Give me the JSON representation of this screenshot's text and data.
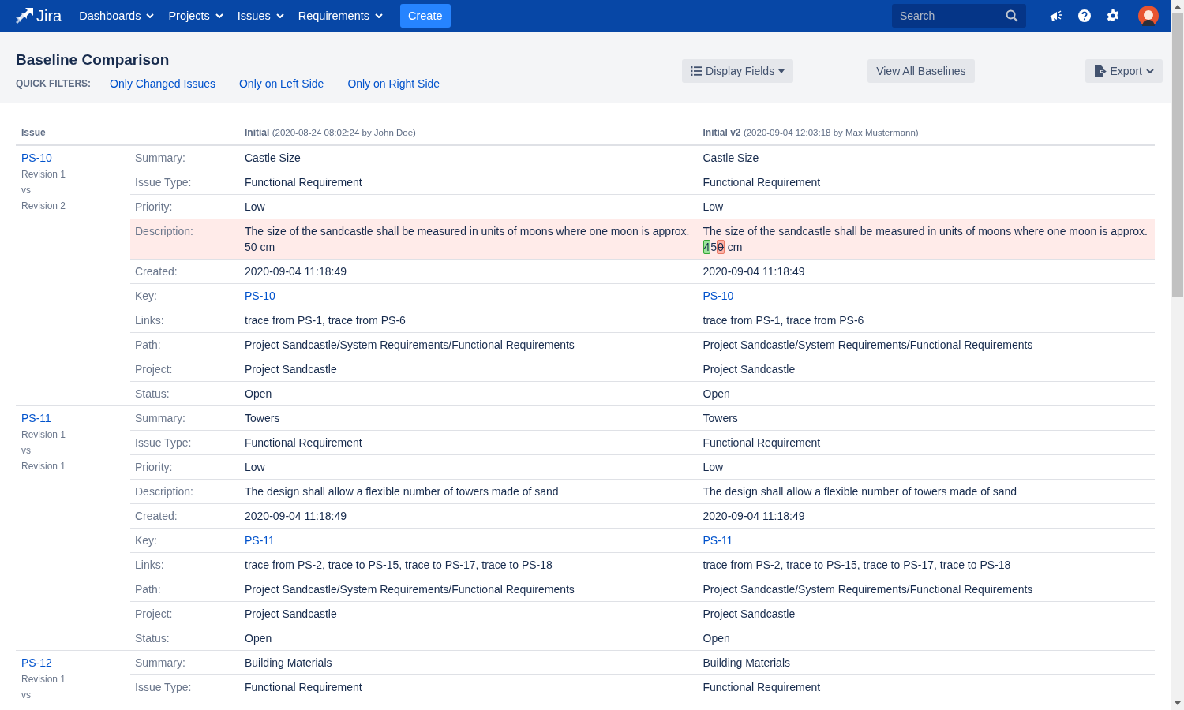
{
  "nav": {
    "logo": "Jira",
    "menus": [
      {
        "label": "Dashboards"
      },
      {
        "label": "Projects"
      },
      {
        "label": "Issues"
      },
      {
        "label": "Requirements"
      }
    ],
    "create": "Create",
    "search": {
      "placeholder": "Search"
    }
  },
  "page": {
    "title": "Baseline Comparison",
    "quick_filters_label": "QUICK FILTERS:",
    "quick_filters": [
      "Only Changed Issues",
      "Only on Left Side",
      "Only on Right Side"
    ],
    "buttons": {
      "display_fields": "Display Fields",
      "view_all": "View All Baselines",
      "export": "Export"
    }
  },
  "table": {
    "columns": {
      "issue": "Issue",
      "left_name": "Initial",
      "left_meta": "(2020-08-24 08:02:24 by John Doe)",
      "right_name": "Initial v2",
      "right_meta": "(2020-09-04 12:03:18 by Max Mustermann)"
    },
    "issues": [
      {
        "key": "PS-10",
        "revisions": [
          "Revision 1",
          "vs",
          "Revision 2"
        ],
        "rows": [
          {
            "label": "Summary:",
            "kind": "text",
            "changed": false,
            "left": "Castle Size",
            "right": "Castle Size"
          },
          {
            "label": "Issue Type:",
            "kind": "text",
            "changed": false,
            "left": "Functional Requirement",
            "right": "Functional Requirement"
          },
          {
            "label": "Priority:",
            "kind": "text",
            "changed": false,
            "left": "Low",
            "right": "Low"
          },
          {
            "label": "Description:",
            "kind": "text",
            "changed": true,
            "left": "The size of the sandcastle shall be measured in units of moons where one moon is approx. 50 cm",
            "right": [
              {
                "kind": "same",
                "text": "The size of the sandcastle shall be measured in units of moons where one moon is approx. "
              },
              {
                "kind": "added",
                "text": "4"
              },
              {
                "kind": "same",
                "text": "5"
              },
              {
                "kind": "removed",
                "text": "0"
              },
              {
                "kind": "same",
                "text": " cm"
              }
            ]
          },
          {
            "label": "Created:",
            "kind": "text",
            "changed": false,
            "left": "2020-09-04 11:18:49",
            "right": "2020-09-04 11:18:49"
          },
          {
            "label": "Key:",
            "kind": "link",
            "changed": false,
            "left": "PS-10",
            "right": "PS-10"
          },
          {
            "label": "Links:",
            "kind": "text",
            "changed": false,
            "left": "trace from PS-1, trace from PS-6",
            "right": "trace from PS-1, trace from PS-6"
          },
          {
            "label": "Path:",
            "kind": "text",
            "changed": false,
            "left": "Project Sandcastle/System Requirements/Functional Requirements",
            "right": "Project Sandcastle/System Requirements/Functional Requirements"
          },
          {
            "label": "Project:",
            "kind": "text",
            "changed": false,
            "left": "Project Sandcastle",
            "right": "Project Sandcastle"
          },
          {
            "label": "Status:",
            "kind": "text",
            "changed": false,
            "left": "Open",
            "right": "Open"
          }
        ]
      },
      {
        "key": "PS-11",
        "revisions": [
          "Revision 1",
          "vs",
          "Revision 1"
        ],
        "rows": [
          {
            "label": "Summary:",
            "kind": "text",
            "changed": false,
            "left": "Towers",
            "right": "Towers"
          },
          {
            "label": "Issue Type:",
            "kind": "text",
            "changed": false,
            "left": "Functional Requirement",
            "right": "Functional Requirement"
          },
          {
            "label": "Priority:",
            "kind": "text",
            "changed": false,
            "left": "Low",
            "right": "Low"
          },
          {
            "label": "Description:",
            "kind": "text",
            "changed": false,
            "left": "The design shall allow a flexible number of towers made of sand",
            "right": "The design shall allow a flexible number of towers made of sand"
          },
          {
            "label": "Created:",
            "kind": "text",
            "changed": false,
            "left": "2020-09-04 11:18:49",
            "right": "2020-09-04 11:18:49"
          },
          {
            "label": "Key:",
            "kind": "link",
            "changed": false,
            "left": "PS-11",
            "right": "PS-11"
          },
          {
            "label": "Links:",
            "kind": "text",
            "changed": false,
            "left": "trace from PS-2, trace to PS-15, trace to PS-17, trace to PS-18",
            "right": "trace from PS-2, trace to PS-15, trace to PS-17, trace to PS-18"
          },
          {
            "label": "Path:",
            "kind": "text",
            "changed": false,
            "left": "Project Sandcastle/System Requirements/Functional Requirements",
            "right": "Project Sandcastle/System Requirements/Functional Requirements"
          },
          {
            "label": "Project:",
            "kind": "text",
            "changed": false,
            "left": "Project Sandcastle",
            "right": "Project Sandcastle"
          },
          {
            "label": "Status:",
            "kind": "text",
            "changed": false,
            "left": "Open",
            "right": "Open"
          }
        ]
      },
      {
        "key": "PS-12",
        "revisions": [
          "Revision 1",
          "vs"
        ],
        "rows": [
          {
            "label": "Summary:",
            "kind": "text",
            "changed": false,
            "left": "Building Materials",
            "right": "Building Materials"
          },
          {
            "label": "Issue Type:",
            "kind": "text",
            "changed": false,
            "left": "Functional Requirement",
            "right": "Functional Requirement"
          }
        ]
      }
    ]
  }
}
